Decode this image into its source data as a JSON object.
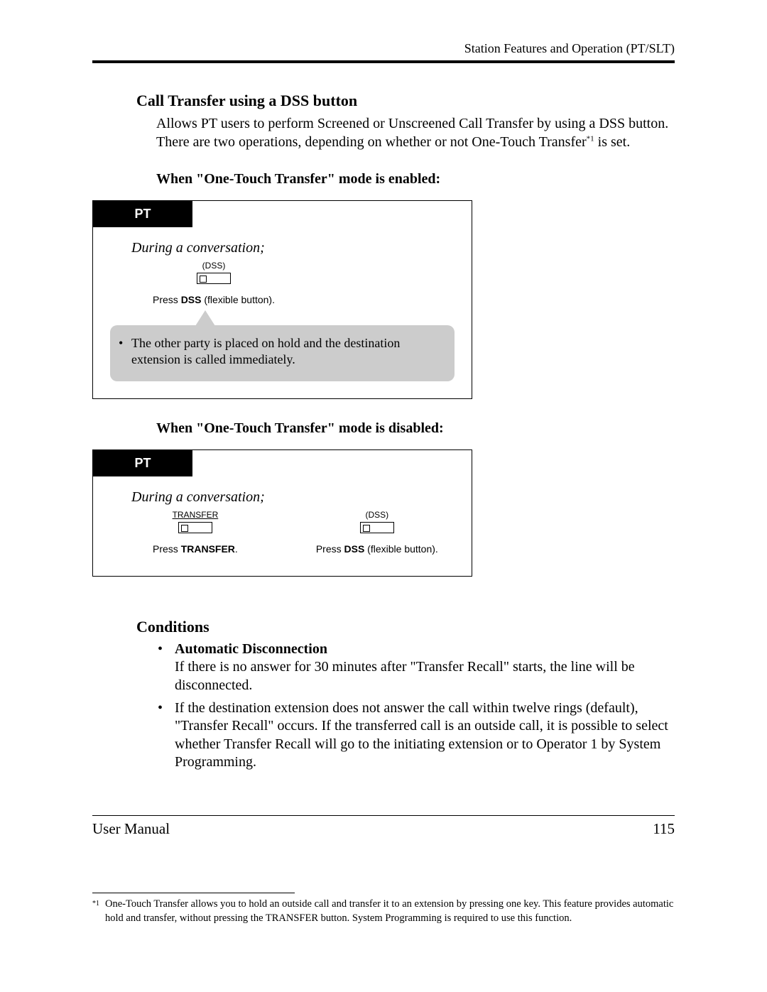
{
  "header": {
    "running": "Station Features and Operation (PT/SLT)"
  },
  "section": {
    "title": "Call Transfer using a DSS button",
    "intro1": "Allows PT users to perform Screened or Unscreened Call Transfer by using a DSS button.",
    "intro2a": "There are two operations, depending on whether or not One-Touch Transfer",
    "intro2_ref": "*1",
    "intro2b": " is set."
  },
  "mode_enabled": {
    "heading": "When \"One-Touch Transfer\" mode is enabled:",
    "tab": "PT",
    "during": "During a conversation;",
    "btn_label": "(DSS)",
    "caption_pre": "Press ",
    "caption_bold": "DSS",
    "caption_post": " (flexible button).",
    "callout": "The other party is placed on hold and the destination extension is called immediately."
  },
  "mode_disabled": {
    "heading": "When \"One-Touch Transfer\" mode is disabled:",
    "tab": "PT",
    "during": "During a conversation;",
    "btn1_label": "TRANSFER",
    "btn1_cap_pre": "Press ",
    "btn1_cap_bold": "TRANSFER",
    "btn1_cap_post": ".",
    "btn2_label": "(DSS)",
    "btn2_cap_pre": "Press ",
    "btn2_cap_bold": "DSS",
    "btn2_cap_post": " (flexible button)."
  },
  "conditions": {
    "title": "Conditions",
    "item1_bold": "Automatic Disconnection",
    "item1_text": "If there is no answer for 30 minutes after \"Transfer Recall\" starts, the line will be disconnected.",
    "item2_text": "If the destination extension does not answer the call within twelve rings (default), \"Transfer Recall\" occurs. If the transferred call is an outside call, it is possible to select whether Transfer Recall will go to the initiating extension or to Operator 1 by System Programming."
  },
  "footnote": {
    "mark": "*1",
    "text": "One-Touch Transfer allows you to hold an outside call and transfer it to an extension by pressing one key. This feature provides automatic hold and transfer, without pressing the TRANSFER button. System Programming is required to use this function."
  },
  "footer": {
    "left": "User Manual",
    "right": "115"
  }
}
